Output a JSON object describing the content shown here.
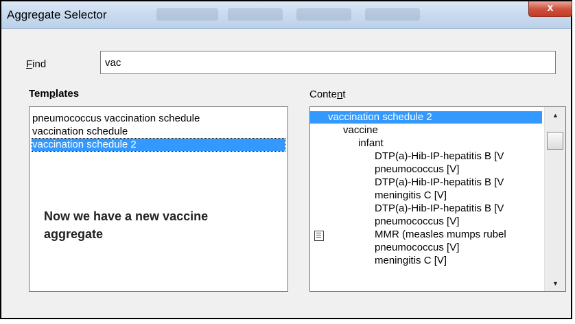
{
  "window": {
    "title": "Aggregate Selector",
    "close_glyph": "x"
  },
  "find": {
    "label_accel": "F",
    "label_rest": "ind",
    "value": "vac"
  },
  "templates": {
    "label_pre": "Tem",
    "label_accel": "p",
    "label_post": "lates",
    "items": [
      "pneumococcus vaccination schedule",
      "vaccination schedule",
      "vaccination schedule 2"
    ],
    "selected_index": 2
  },
  "annotation": {
    "line1": "Now we have a new vaccine",
    "line2": "aggregate"
  },
  "content": {
    "label_pre": "Conte",
    "label_accel": "n",
    "label_post": "t",
    "rows": [
      "vaccination schedule 2",
      "vaccine",
      "infant",
      "DTP(a)-Hib-IP-hepatitis B [V",
      "pneumococcus [V]",
      "DTP(a)-Hib-IP-hepatitis B [V",
      "meningitis C [V]",
      "DTP(a)-Hib-IP-hepatitis B [V",
      "pneumococcus [V]",
      "MMR (measles mumps rubel",
      "pneumococcus [V]",
      "meningitis C [V]"
    ],
    "selected_index": 0,
    "icon_row_index": 9,
    "row_icon": "note-icon"
  },
  "scrollbar": {
    "up_glyph": "▲",
    "down_glyph": "▼"
  },
  "colors": {
    "selection": "#3399ff",
    "close_button": "#c13a25"
  }
}
